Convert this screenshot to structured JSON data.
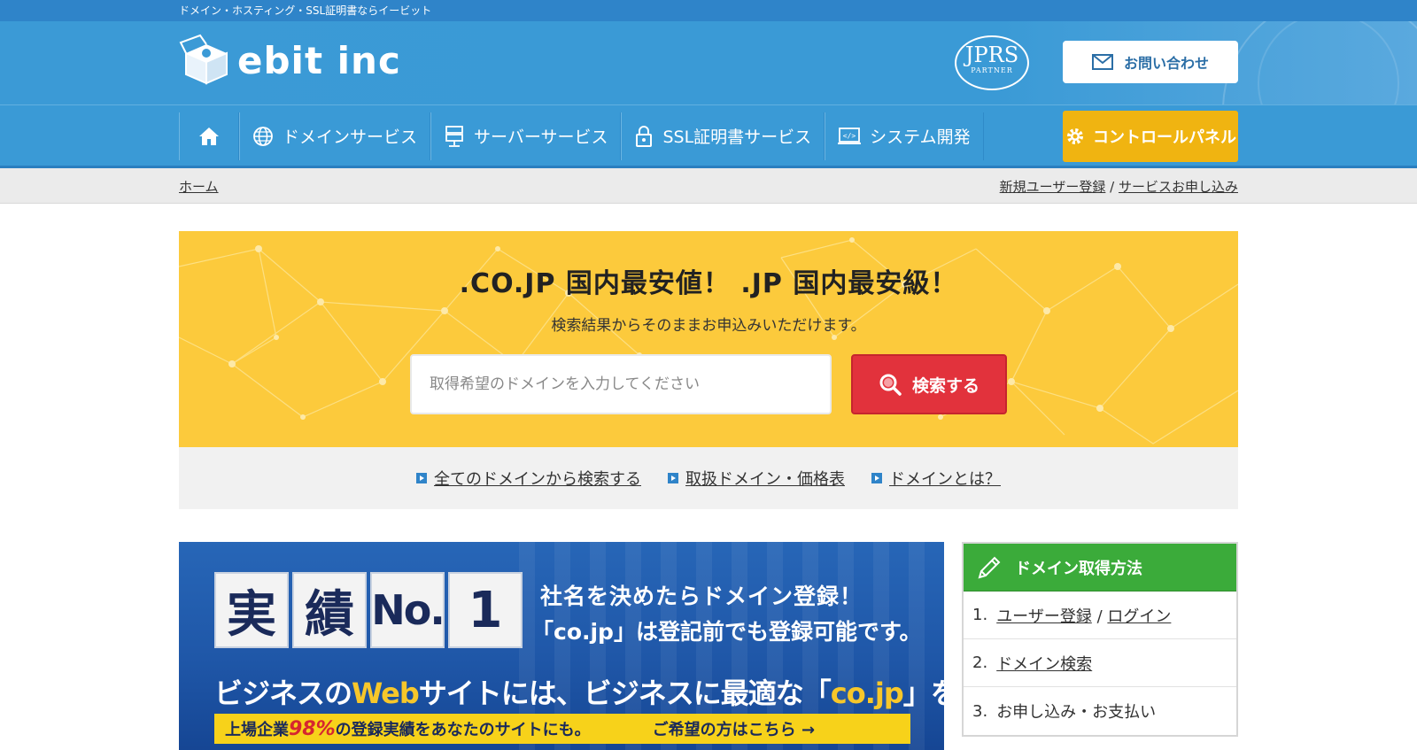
{
  "topstrip": {
    "text": "ドメイン・ホスティング・SSL証明書ならイービット"
  },
  "header": {
    "logo_text": "ebit inc",
    "jprs_text": "JPRS",
    "jprs_sub": "PARTNER",
    "contact_label": "お問い合わせ"
  },
  "nav": {
    "items": [
      {
        "label": "ドメインサービス",
        "icon": "globe-icon"
      },
      {
        "label": "サーバーサービス",
        "icon": "server-icon"
      },
      {
        "label": "SSL証明書サービス",
        "icon": "lock-icon"
      },
      {
        "label": "システム開発",
        "icon": "code-icon"
      }
    ],
    "control_label": "コントロールパネル"
  },
  "breadcrumb": {
    "home": "ホーム",
    "register": "新規ユーザー登録",
    "separator": "/",
    "apply": "サービスお申し込み"
  },
  "hero": {
    "title": ".CO.JP 国内最安値！ .JP 国内最安級！",
    "subtitle": "検索結果からそのままお申込みいただけます。",
    "search_placeholder": "取得希望のドメインを入力してください",
    "search_button": "検索する"
  },
  "links": [
    "全てのドメインから検索する",
    "取扱ドメイン・価格表",
    "ドメインとは？"
  ],
  "banner": {
    "k1": "実",
    "k2": "績",
    "k3": "No.",
    "k4": "1",
    "line1": "社名を決めたらドメイン登録！",
    "line2": "「co.jp」は登記前でも登録可能です。",
    "line3a": "ビジネスの",
    "line3b": "Web",
    "line3c": "サイトには、ビジネスに最適な「",
    "line3d": "co.jp",
    "line3e": "」を。",
    "strip_a": "上場企業",
    "strip_pct": "98%",
    "strip_b": "の登録実績をあなたのサイトにも。",
    "strip_c": "ご希望の方はこちら →"
  },
  "steps": {
    "title": "ドメイン取得方法",
    "s1_num": "1.",
    "s1_link1": "ユーザー登録",
    "s1_sep": "/",
    "s1_link2": "ログイン",
    "s2_num": "2.",
    "s2_link": "ドメイン検索",
    "s3_num": "3.",
    "s3_text": "お申し込み・お支払い"
  }
}
